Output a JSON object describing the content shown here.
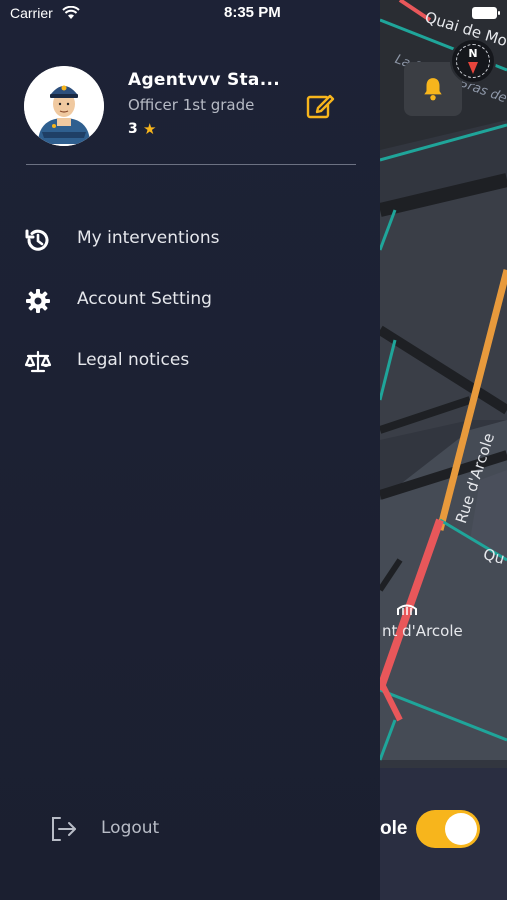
{
  "status_bar": {
    "carrier": "Carrier",
    "time": "8:35 PM"
  },
  "map": {
    "labels": {
      "quai_de_mo": "Quai de Mo",
      "la_seine": "La Seine - Bras de",
      "rue_darcole": "Rue d'Arcole",
      "qu": "Qu",
      "pont_darcole": "nt d'Arcole"
    },
    "toggle_label": "ole",
    "toggle_on": true
  },
  "profile": {
    "name": "Agentvvv Sta...",
    "grade": "Officer 1st grade",
    "rating": "3"
  },
  "menu": [
    {
      "label": "My interventions",
      "icon": "history-icon"
    },
    {
      "label": "Account Setting",
      "icon": "gear-icon"
    },
    {
      "label": "Legal notices",
      "icon": "scales-icon"
    }
  ],
  "logout_label": "Logout",
  "colors": {
    "accent": "#f7b51c",
    "drawer_bg": "#1d2236",
    "road_traffic": "#e8575a",
    "road_teal": "#1fa59a",
    "road_orange": "#e89a3c"
  }
}
